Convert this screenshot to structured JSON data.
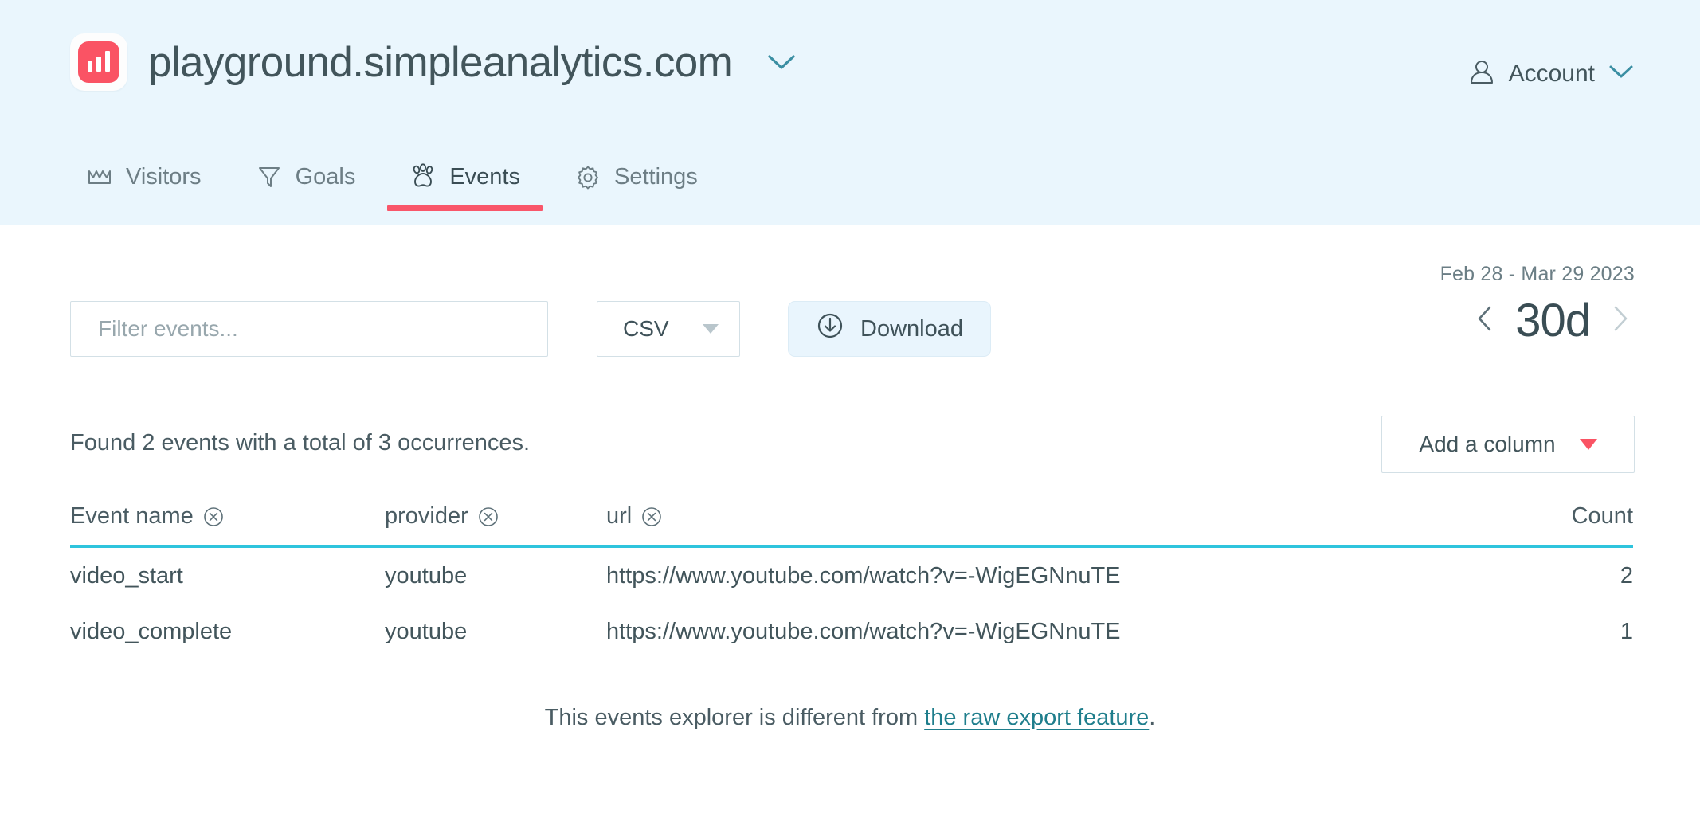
{
  "header": {
    "site_title": "playground.simpleanalytics.com",
    "logo_icon": "bar-chart-logo-icon",
    "title_chevron_icon": "chevron-down-icon",
    "account": {
      "label": "Account",
      "icon": "user-icon",
      "chevron_icon": "chevron-down-icon"
    },
    "background_color": "#eaf6fd"
  },
  "nav": {
    "active": "Events",
    "active_underline_color": "#f9566a",
    "tabs": [
      {
        "label": "Visitors",
        "icon": "visitors-chart-icon",
        "active": false
      },
      {
        "label": "Goals",
        "icon": "funnel-icon",
        "active": false
      },
      {
        "label": "Events",
        "icon": "paw-print-icon",
        "active": true
      },
      {
        "label": "Settings",
        "icon": "gear-icon",
        "active": false
      }
    ]
  },
  "controls": {
    "filter": {
      "value": "",
      "placeholder": "Filter events...",
      "name": "Filter events..."
    },
    "format_select": {
      "selected": "CSV",
      "caret_icon": "caret-down-icon"
    },
    "download": {
      "label": "Download",
      "icon": "download-circle-icon",
      "background_color": "#e9f5fd"
    }
  },
  "daterange": {
    "range_label": "Feb 28 - Mar 29 2023",
    "period": "30d",
    "prev_icon": "chevron-left-icon",
    "next_icon": "chevron-right-icon"
  },
  "summary": {
    "text": "Found 2 events with a total of 3 occurrences.",
    "events_found": 2,
    "total_occurrences": 3
  },
  "add_column": {
    "label": "Add a column",
    "caret_icon": "caret-down-icon",
    "caret_color": "#fa5364"
  },
  "table": {
    "header_underline_color": "#2ec4dd",
    "columns": [
      {
        "label": "Event name",
        "removable": true,
        "remove_icon": "remove-circle-icon"
      },
      {
        "label": "provider",
        "removable": true,
        "remove_icon": "remove-circle-icon"
      },
      {
        "label": "url",
        "removable": true,
        "remove_icon": "remove-circle-icon"
      },
      {
        "label": "Count",
        "removable": false
      }
    ],
    "rows": [
      {
        "event_name": "video_start",
        "provider": "youtube",
        "url": "https://www.youtube.com/watch?v=-WigEGNnuTE",
        "count": "2"
      },
      {
        "event_name": "video_complete",
        "provider": "youtube",
        "url": "https://www.youtube.com/watch?v=-WigEGNnuTE",
        "count": "1"
      }
    ]
  },
  "footer": {
    "text_before": "This events explorer is different from ",
    "link_text": "the raw export feature",
    "text_after": "."
  }
}
